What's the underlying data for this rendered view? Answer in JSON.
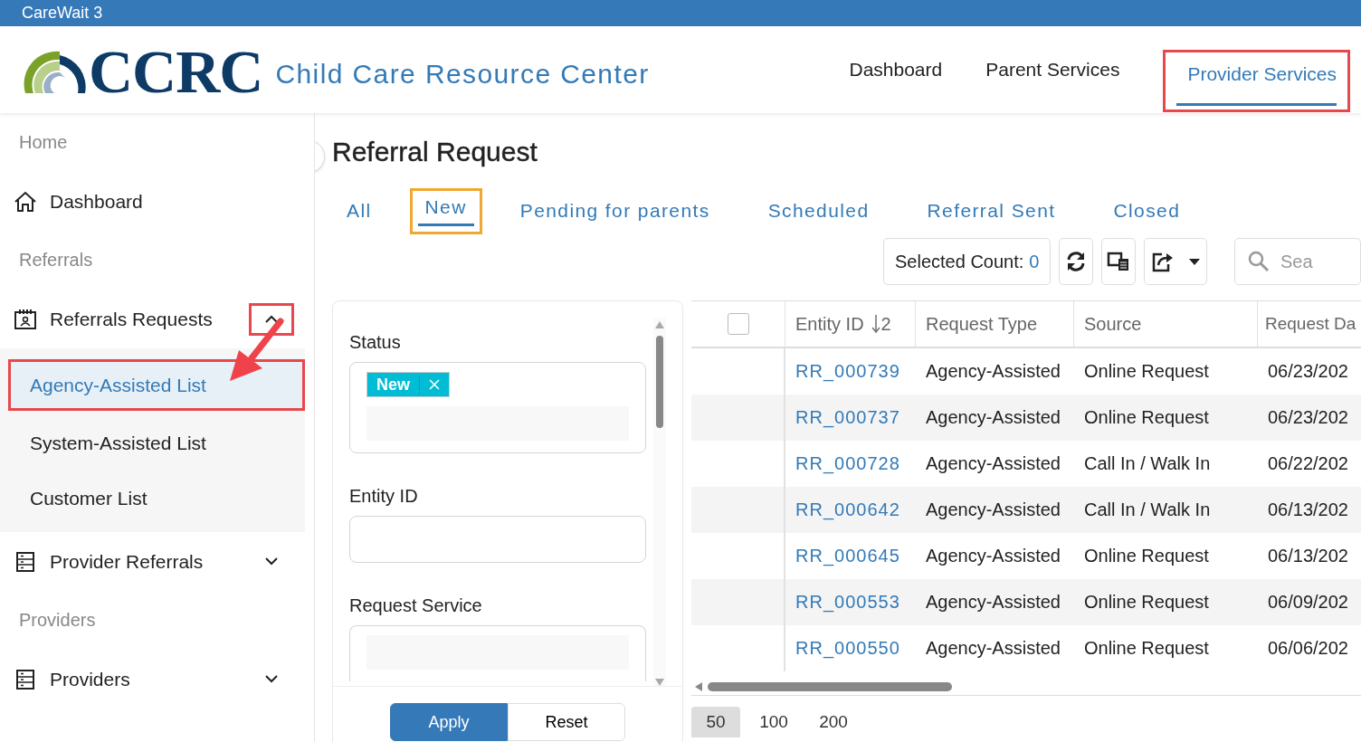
{
  "app_title": "CareWait 3",
  "logo": {
    "mark": "CCRC",
    "name": "Child Care Resource Center"
  },
  "top_nav": [
    {
      "label": "Dashboard",
      "selected": false,
      "highlighted": false
    },
    {
      "label": "Parent Services",
      "selected": false,
      "highlighted": false
    },
    {
      "label": "Provider Services",
      "selected": true,
      "highlighted": true
    }
  ],
  "sidebar": {
    "items": [
      {
        "kind": "heading",
        "label": "Home"
      },
      {
        "kind": "link",
        "label": "Dashboard"
      },
      {
        "kind": "heading",
        "label": "Referrals"
      },
      {
        "kind": "group",
        "label": "Referrals Requests",
        "expanded": true,
        "highlighted": true,
        "children": [
          {
            "label": "Agency-Assisted List",
            "selected": true,
            "highlighted": true
          },
          {
            "label": "System-Assisted List",
            "selected": false,
            "highlighted": false
          },
          {
            "label": "Customer List",
            "selected": false,
            "highlighted": false
          }
        ]
      },
      {
        "kind": "group",
        "label": "Provider Referrals",
        "expanded": false,
        "highlighted": false
      },
      {
        "kind": "heading",
        "label": "Providers"
      },
      {
        "kind": "group",
        "label": "Providers",
        "expanded": false,
        "highlighted": false
      }
    ]
  },
  "page_title": "Referral Request",
  "tabs": [
    {
      "label": "All",
      "selected": false,
      "highlighted": false
    },
    {
      "label": "New",
      "selected": true,
      "highlighted": true
    },
    {
      "label": "Pending for parents",
      "selected": false,
      "highlighted": false
    },
    {
      "label": "Scheduled",
      "selected": false,
      "highlighted": false
    },
    {
      "label": "Referral Sent",
      "selected": false,
      "highlighted": false
    },
    {
      "label": "Closed",
      "selected": false,
      "highlighted": false
    }
  ],
  "toolbar": {
    "selected_count_label": "Selected Count:",
    "selected_count": "0",
    "search_placeholder": "Sea"
  },
  "filters": {
    "fields": [
      {
        "kind": "tags",
        "label": "Status",
        "tags": [
          "New"
        ]
      },
      {
        "kind": "text",
        "label": "Entity ID"
      },
      {
        "kind": "select",
        "label": "Request Service"
      }
    ],
    "buttons": [
      {
        "label": "Apply",
        "primary": true
      },
      {
        "label": "Reset",
        "primary": false
      }
    ]
  },
  "table": {
    "select_all_checked": false,
    "columns": [
      {
        "label": "Entity ID",
        "sort_order": "2"
      },
      {
        "label": "Request Type"
      },
      {
        "label": "Source"
      },
      {
        "label": "Request Da"
      }
    ],
    "rows": [
      [
        "RR_000739",
        "Agency-Assisted",
        "Online Request",
        "06/23/202"
      ],
      [
        "RR_000737",
        "Agency-Assisted",
        "Online Request",
        "06/23/202"
      ],
      [
        "RR_000728",
        "Agency-Assisted",
        "Call In / Walk In",
        "06/22/202"
      ],
      [
        "RR_000642",
        "Agency-Assisted",
        "Call In / Walk In",
        "06/13/202"
      ],
      [
        "RR_000645",
        "Agency-Assisted",
        "Online Request",
        "06/13/202"
      ],
      [
        "RR_000553",
        "Agency-Assisted",
        "Online Request",
        "06/09/202"
      ],
      [
        "RR_000550",
        "Agency-Assisted",
        "Online Request",
        "06/06/202"
      ]
    ]
  },
  "page_sizes": [
    {
      "label": "50",
      "selected": true
    },
    {
      "label": "100",
      "selected": false
    },
    {
      "label": "200",
      "selected": false
    }
  ]
}
